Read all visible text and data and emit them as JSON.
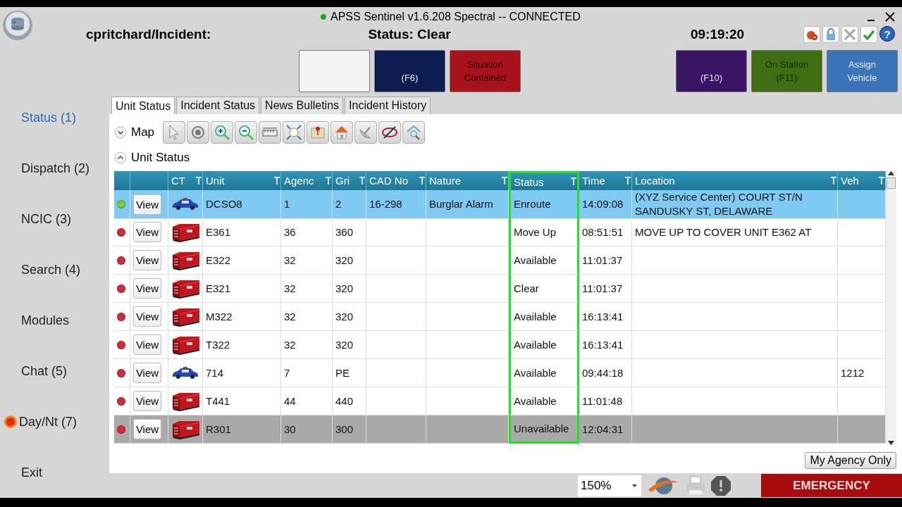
{
  "window": {
    "title": "APSS Sentinel v1.6.208 Spectral -- CONNECTED",
    "connected": true
  },
  "header": {
    "user": "cpritchard/Incident:",
    "status": "Status: Clear",
    "clock": "09:19:20",
    "help": "?"
  },
  "action_buttons": [
    {
      "color": "#f4f4f4"
    },
    {
      "label": "(F6)",
      "color": "#0d1d52"
    },
    {
      "label": "Situation Contained",
      "color": "#a8121c"
    },
    {
      "label": "(F10)",
      "color": "#3a1466"
    },
    {
      "label": "On Station (F11)",
      "color": "#3f6e12"
    },
    {
      "label": "Assign Vehicle",
      "color": "#3a74b8"
    }
  ],
  "sidebar": {
    "items": [
      {
        "label": "Status (1)",
        "selected": true,
        "kind": "plain"
      },
      {
        "label": "Dispatch (2)",
        "selected": false,
        "kind": "plain"
      },
      {
        "label": "NCIC (3)",
        "selected": false,
        "kind": "plain"
      },
      {
        "label": "Search (4)",
        "selected": false,
        "kind": "plain"
      },
      {
        "label": "Modules",
        "selected": false,
        "kind": "plain"
      },
      {
        "label": "Chat (5)",
        "selected": false,
        "kind": "plain"
      },
      {
        "label": "Day/Nt (7)",
        "selected": false,
        "kind": "daynight"
      },
      {
        "label": "Exit",
        "selected": false,
        "kind": "plain"
      }
    ]
  },
  "tabs": [
    {
      "label": "Unit Status",
      "selected": true
    },
    {
      "label": "Incident Status",
      "selected": false
    },
    {
      "label": "News Bulletins",
      "selected": false
    },
    {
      "label": "Incident History",
      "selected": false
    }
  ],
  "map_section": {
    "label": "Map",
    "expanded": false
  },
  "unit_section": {
    "label": "Unit Status",
    "expanded": true
  },
  "table": {
    "columns": [
      {
        "label": "CT",
        "highlighted": false
      },
      {
        "label": "Unit",
        "highlighted": false
      },
      {
        "label": "Agenc",
        "highlighted": false
      },
      {
        "label": "Gri",
        "highlighted": false
      },
      {
        "label": "CAD No",
        "highlighted": false
      },
      {
        "label": "Nature",
        "highlighted": false
      },
      {
        "label": "Status",
        "highlighted": true
      },
      {
        "label": "Time",
        "highlighted": false
      },
      {
        "label": "Location",
        "highlighted": false
      },
      {
        "label": "Veh",
        "highlighted": false
      }
    ],
    "rows": [
      {
        "color": "#7ccf3c",
        "button": "View",
        "kind": "car",
        "unit": "DCSO8",
        "agency": "1",
        "grid": "2",
        "cad_no": "16-298",
        "nature": "Burglar Alarm",
        "status": "Enroute",
        "time": "14:09:08",
        "location": "(XYZ Service Center) COURT ST/N SANDUSKY ST, DELAWARE",
        "selected": true,
        "shaded": false
      },
      {
        "color": "#d9283a",
        "button": "View",
        "kind": "engine",
        "unit": "E361",
        "agency": "36",
        "grid": "360",
        "status": "Move Up",
        "time": "08:51:51",
        "location": "MOVE UP TO COVER UNIT E362 AT",
        "selected": false,
        "shaded": false
      },
      {
        "color": "#d9283a",
        "button": "View",
        "kind": "engine",
        "unit": "E322",
        "agency": "32",
        "grid": "320",
        "status": "Available",
        "time": "11:01:37",
        "selected": false,
        "shaded": false
      },
      {
        "color": "#d9283a",
        "button": "View",
        "kind": "engine",
        "unit": "E321",
        "agency": "32",
        "grid": "320",
        "status": "Clear",
        "time": "11:01:37",
        "selected": false,
        "shaded": false
      },
      {
        "color": "#d9283a",
        "button": "View",
        "kind": "engine",
        "unit": "M322",
        "agency": "32",
        "grid": "320",
        "status": "Available",
        "time": "16:13:41",
        "selected": false,
        "shaded": false
      },
      {
        "color": "#d9283a",
        "button": "View",
        "kind": "engine",
        "unit": "T322",
        "agency": "32",
        "grid": "320",
        "status": "Available",
        "time": "16:13:41",
        "selected": false,
        "shaded": false
      },
      {
        "color": "#d9283a",
        "button": "View",
        "kind": "car",
        "unit": "714",
        "agency": "7",
        "grid": "PE",
        "status": "Available",
        "time": "09:44:18",
        "veh": "1212",
        "selected": false,
        "shaded": false
      },
      {
        "color": "#d9283a",
        "button": "View",
        "kind": "engine",
        "unit": "T441",
        "agency": "44",
        "grid": "440",
        "status": "Available",
        "time": "11:01:48",
        "selected": false,
        "shaded": false
      },
      {
        "color": "#d9283a",
        "button": "View",
        "kind": "engine",
        "unit": "R301",
        "agency": "30",
        "grid": "300",
        "status": "Unavailable",
        "time": "12:04:31",
        "selected": false,
        "shaded": true
      }
    ]
  },
  "filter_button": "My Agency Only",
  "status_bar": {
    "zoom": "150%",
    "emergency": "EMERGENCY"
  }
}
